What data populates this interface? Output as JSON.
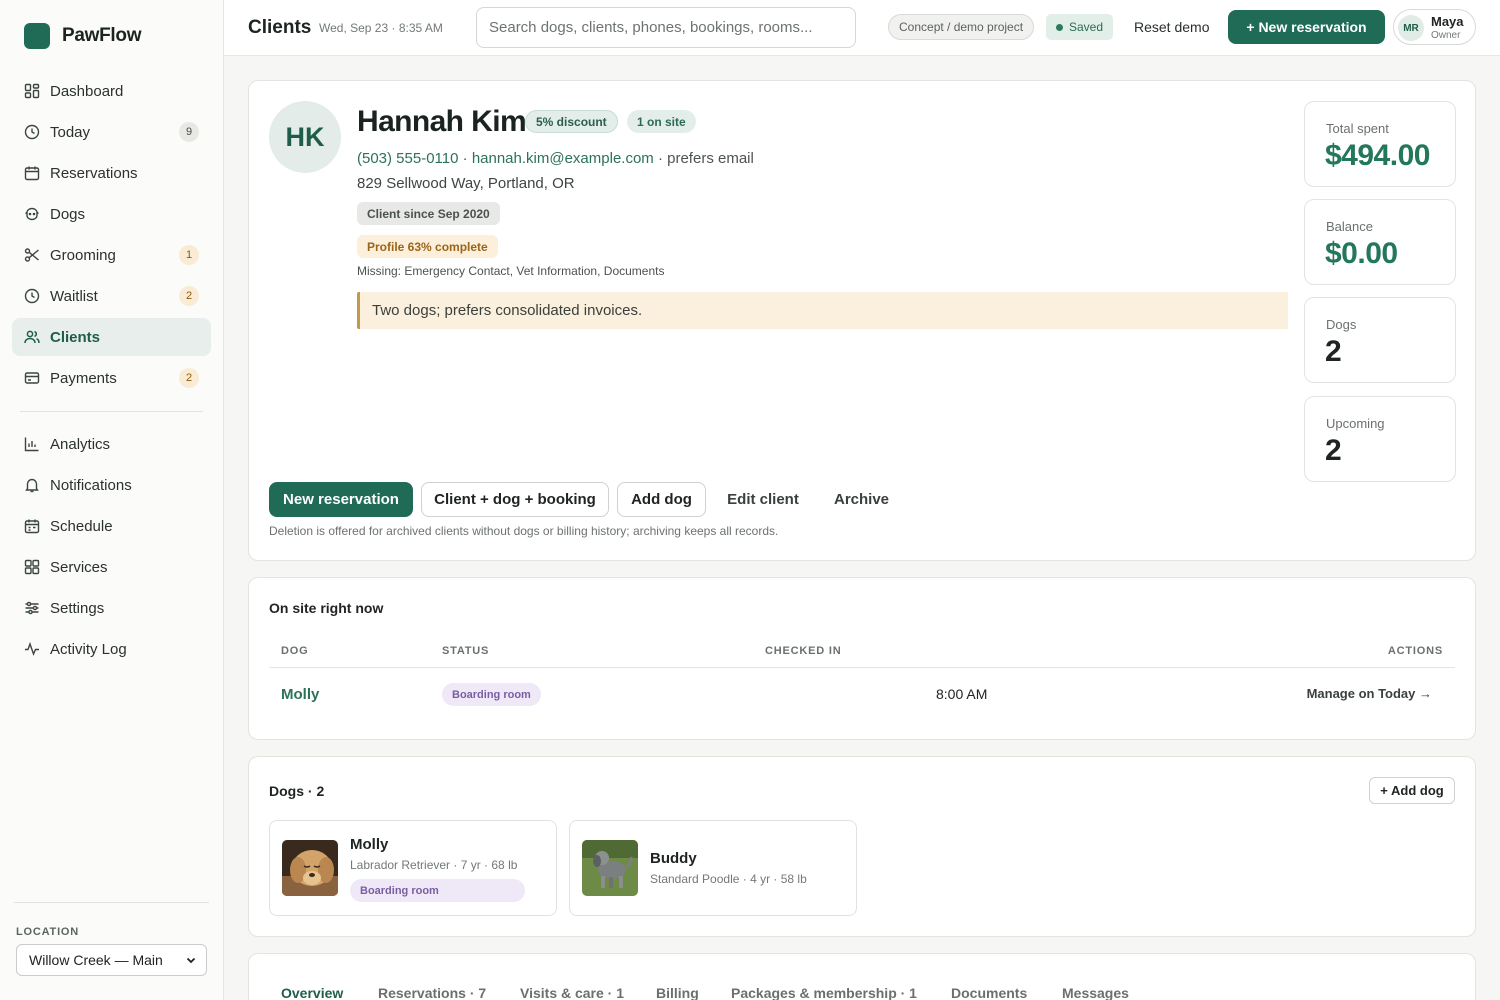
{
  "app": {
    "name": "PawFlow"
  },
  "sidebar": {
    "items": [
      {
        "label": "Dashboard",
        "icon": "grid-icon",
        "badge": ""
      },
      {
        "label": "Today",
        "icon": "clock-icon",
        "badge": "9",
        "badge_style": "gray"
      },
      {
        "label": "Reservations",
        "icon": "calendar-icon",
        "badge": ""
      },
      {
        "label": "Dogs",
        "icon": "paw-icon",
        "badge": ""
      },
      {
        "label": "Grooming",
        "icon": "scissors-icon",
        "badge": "1",
        "badge_style": "amber"
      },
      {
        "label": "Waitlist",
        "icon": "clock-icon",
        "badge": "2",
        "badge_style": "amber"
      },
      {
        "label": "Clients",
        "icon": "users-icon",
        "badge": "",
        "active": true
      },
      {
        "label": "Payments",
        "icon": "credit-card-icon",
        "badge": "2",
        "badge_style": "amber"
      }
    ],
    "secondary": [
      {
        "label": "Analytics",
        "icon": "bar-chart-icon"
      },
      {
        "label": "Notifications",
        "icon": "bell-icon"
      },
      {
        "label": "Schedule",
        "icon": "calendar-icon"
      },
      {
        "label": "Services",
        "icon": "grid-icon"
      },
      {
        "label": "Settings",
        "icon": "sliders-icon"
      },
      {
        "label": "Activity Log",
        "icon": "activity-icon"
      }
    ],
    "location": {
      "label": "LOCATION",
      "value": "Willow Creek — Main"
    }
  },
  "topbar": {
    "title": "Clients",
    "date": "Wed, Sep 23 · 8:35 AM",
    "search_placeholder": "Search dogs, clients, phones, bookings, rooms...",
    "concept_pill": "Concept / demo project",
    "saved_pill": "Saved",
    "reset_label": "Reset demo",
    "new_reservation_label": "+ New reservation",
    "user": {
      "initials": "MR",
      "name": "Maya",
      "role": "Owner"
    }
  },
  "client": {
    "initials": "HK",
    "name": "Hannah Kim",
    "discount_tag": "5% discount",
    "onsite_tag": "1 on site",
    "phone": "(503) 555-0110",
    "email": "hannah.kim@example.com",
    "contact_pref": "· prefers email",
    "address": "829 Sellwood Way, Portland, OR",
    "since": "Client since Sep 2020",
    "profile_complete": "Profile 63% complete",
    "missing": "Missing: Emergency Contact, Vet Information, Documents",
    "note": "Two dogs; prefers consolidated invoices.",
    "stats": [
      {
        "label": "Total spent",
        "value": "$494.00",
        "green": true
      },
      {
        "label": "Balance",
        "value": "$0.00",
        "green": true
      },
      {
        "label": "Dogs",
        "value": "2",
        "green": false
      },
      {
        "label": "Upcoming",
        "value": "2",
        "green": false
      }
    ],
    "actions": {
      "new_reservation": "New reservation",
      "client_dog_booking": "Client + dog + booking",
      "add_dog": "Add dog",
      "edit_client": "Edit client",
      "archive": "Archive"
    },
    "deletion_note": "Deletion is offered for archived clients without dogs or billing history; archiving keeps all records."
  },
  "onsite": {
    "title": "On site right now",
    "columns": [
      "DOG",
      "STATUS",
      "CHECKED IN",
      "ACTIONS"
    ],
    "rows": [
      {
        "dog": "Molly",
        "status": "Boarding room",
        "checked_in": "8:00 AM",
        "action": "Manage on Today →"
      }
    ]
  },
  "dogs": {
    "title": "Dogs · 2",
    "add_label": "+ Add dog",
    "items": [
      {
        "name": "Molly",
        "meta": "Labrador Retriever · 7 yr · 68 lb",
        "status": "Boarding room"
      },
      {
        "name": "Buddy",
        "meta": "Standard Poodle · 4 yr · 58 lb",
        "status": ""
      }
    ]
  },
  "tabs": [
    {
      "label": "Overview",
      "active": true
    },
    {
      "label": "Reservations · 7"
    },
    {
      "label": "Visits & care · 1"
    },
    {
      "label": "Billing"
    },
    {
      "label": "Packages & membership · 1"
    },
    {
      "label": "Documents"
    },
    {
      "label": "Messages"
    }
  ],
  "colors": {
    "accent": "#1f6b55",
    "accent_text": "#2b7258",
    "warning_bg": "#faf0dd",
    "purple_pill": "#efe8f6"
  }
}
